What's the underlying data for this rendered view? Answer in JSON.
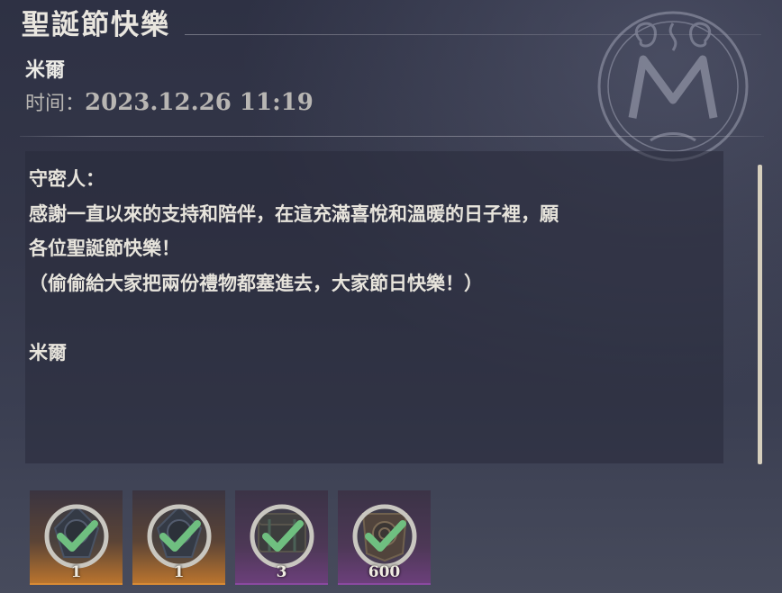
{
  "mail": {
    "title": "聖誕節快樂",
    "sender": "米爾",
    "time_label": "时间：",
    "time_value": "2023.12.26 11:19",
    "body_lines": [
      "守密人：",
      "感謝一直以來的支持和陪伴，在這充滿喜悅和溫暖的日子裡，願",
      "各位聖誕節快樂！",
      "（偷偷給大家把兩份禮物都塞進去，大家節日快樂！）",
      "",
      "米爾"
    ],
    "emblem_icon": "m-monogram-seal-icon"
  },
  "attachments": [
    {
      "count": "1",
      "rarity": "orange",
      "icon": "hooded-figure-item-icon",
      "claimed": true
    },
    {
      "count": "1",
      "rarity": "orange",
      "icon": "hooded-figure-item-icon",
      "claimed": true
    },
    {
      "count": "3",
      "rarity": "purple",
      "icon": "chest-item-icon",
      "claimed": true
    },
    {
      "count": "600",
      "rarity": "purple",
      "icon": "rose-crest-item-icon",
      "claimed": true
    }
  ],
  "colors": {
    "background": "#333648",
    "text": "#e7e4dc",
    "orange_rarity": "#d88a35",
    "purple_rarity": "#8a4aa0",
    "check": "#5fae72"
  }
}
